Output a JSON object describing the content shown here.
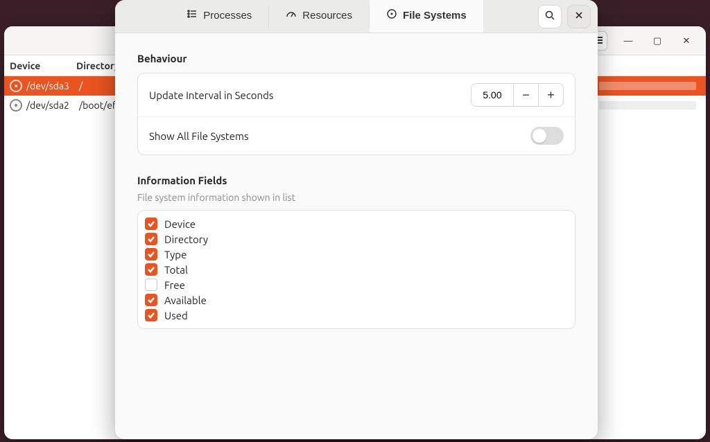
{
  "back_window": {
    "columns": {
      "device": "Device",
      "directory": "Directory"
    },
    "rows": [
      {
        "device": "/dev/sda3",
        "directory": "/",
        "selected": true,
        "usage_pct": 100
      },
      {
        "device": "/dev/sda2",
        "directory": "/boot/efi",
        "selected": false,
        "usage_pct": 4
      }
    ]
  },
  "dialog": {
    "tabs": [
      {
        "id": "processes",
        "label": "Processes",
        "active": false
      },
      {
        "id": "resources",
        "label": "Resources",
        "active": false
      },
      {
        "id": "filesystems",
        "label": "File Systems",
        "active": true
      }
    ],
    "behaviour": {
      "title": "Behaviour",
      "update_interval": {
        "label": "Update Interval in Seconds",
        "value": "5.00"
      },
      "show_all": {
        "label": "Show All File Systems",
        "on": false
      }
    },
    "info_fields": {
      "title": "Information Fields",
      "subtitle": "File system information shown in list",
      "items": [
        {
          "label": "Device",
          "checked": true
        },
        {
          "label": "Directory",
          "checked": true
        },
        {
          "label": "Type",
          "checked": true
        },
        {
          "label": "Total",
          "checked": true
        },
        {
          "label": "Free",
          "checked": false
        },
        {
          "label": "Available",
          "checked": true
        },
        {
          "label": "Used",
          "checked": true
        }
      ]
    }
  }
}
